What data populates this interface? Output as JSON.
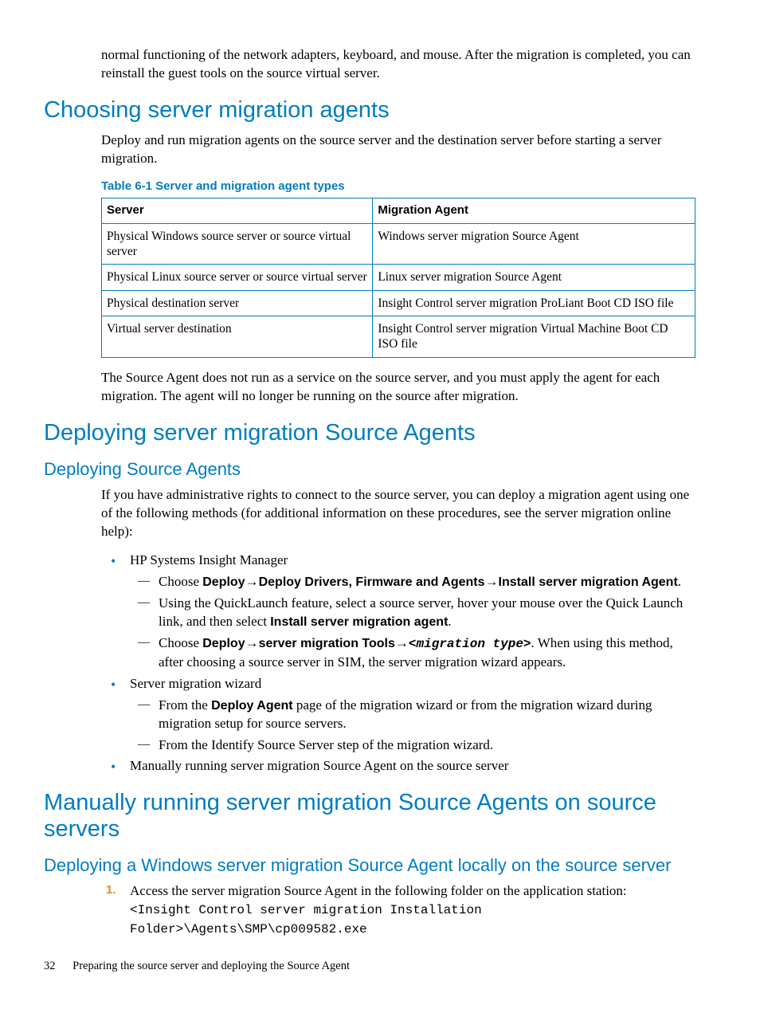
{
  "intro_continued": "normal functioning of the network adapters, keyboard, and mouse. After the migration is completed, you can reinstall the guest tools on the source virtual server.",
  "s1": {
    "title": "Choosing server migration agents",
    "para": "Deploy and run migration agents on the source server and the destination server before starting a server migration.",
    "table_caption": "Table 6-1 Server and migration agent types",
    "table": {
      "headers": [
        "Server",
        "Migration Agent"
      ],
      "rows": [
        [
          "Physical Windows source server or source virtual server",
          "Windows server migration Source Agent"
        ],
        [
          "Physical Linux source server or source virtual server",
          "Linux server migration Source Agent"
        ],
        [
          "Physical destination server",
          "Insight Control server migration ProLiant Boot CD ISO file"
        ],
        [
          "Virtual server destination",
          "Insight Control server migration Virtual Machine Boot CD ISO file"
        ]
      ]
    },
    "after_table": "The Source Agent does not run as a service on the source server, and you must apply the agent for each migration. The agent will no longer be running on the source after migration."
  },
  "s2": {
    "title": "Deploying server migration Source Agents",
    "sub1": {
      "title": "Deploying Source Agents",
      "para": "If you have administrative rights to connect to the source server, you can deploy a migration agent using one of the following methods (for additional information on these procedures, see the server migration online help):",
      "bullets": [
        {
          "text": "HP Systems Insight Manager",
          "dashes": [
            {
              "pre": "Choose ",
              "b1": "Deploy",
              "arrow1": "→",
              "b2": "Deploy Drivers, Firmware and Agents",
              "arrow2": "→",
              "b3": "Install server migration Agent",
              "post": "."
            },
            {
              "pre": "Using the QuickLaunch feature, select a source server, hover your mouse over the Quick Launch link, and then select ",
              "b1": "Install server migration agent",
              "post": "."
            },
            {
              "pre": "Choose ",
              "b1": "Deploy",
              "arrow1": "→",
              "b2": "server migration Tools",
              "arrow2": "→",
              "code": "<migration type>",
              "post": ". When using this method, after choosing a source server in SIM, the server migration wizard appears."
            }
          ]
        },
        {
          "text": "Server migration wizard",
          "dashes": [
            {
              "pre": "From the ",
              "b1": "Deploy Agent",
              "post": " page of the migration wizard or from the migration wizard during migration setup for source servers."
            },
            {
              "pre": "From the Identify Source Server step of the migration wizard."
            }
          ]
        },
        {
          "text": "Manually running server migration Source Agent on the source server"
        }
      ]
    }
  },
  "s3": {
    "title": "Manually running server migration Source Agents on source servers",
    "sub1": {
      "title": "Deploying a Windows server migration Source Agent locally on the source server",
      "step1_text": "Access the server migration Source Agent in the following folder on the application station:",
      "step1_code": "<Insight Control server migration Installation Folder>\\Agents\\SMP\\cp009582.exe"
    }
  },
  "footer": {
    "page": "32",
    "chapter": "Preparing the source server and deploying the Source Agent"
  }
}
